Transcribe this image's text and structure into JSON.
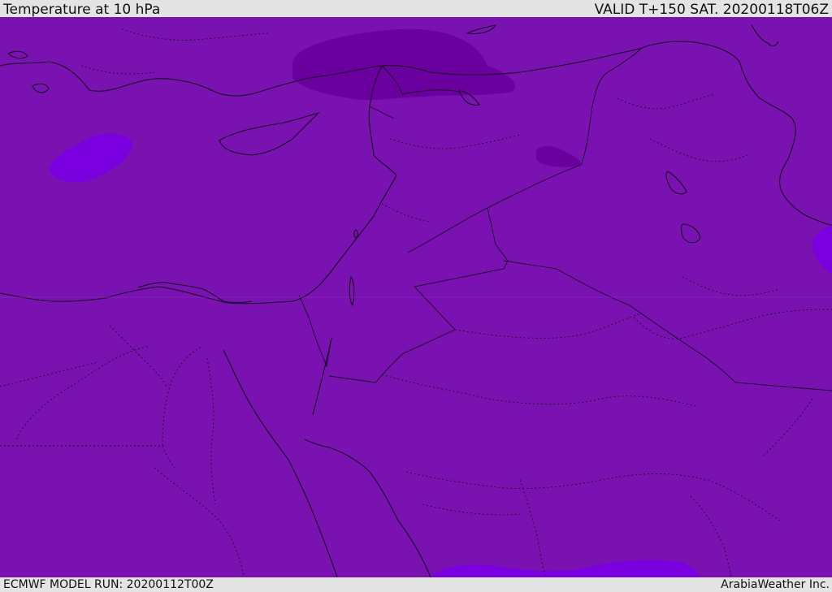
{
  "header": {
    "title": "Temperature at 10 hPa",
    "valid_time": "VALID T+150 SAT. 20200118T06Z"
  },
  "footer": {
    "model_run": "ECMWF MODEL RUN: 20200112T00Z",
    "brand": "ArabiaWeather Inc."
  },
  "map": {
    "base_color": "#7a12b2",
    "cold_color": "#6a009e",
    "warm_color": "#7b00e0",
    "border_color": "#1a0a26"
  }
}
